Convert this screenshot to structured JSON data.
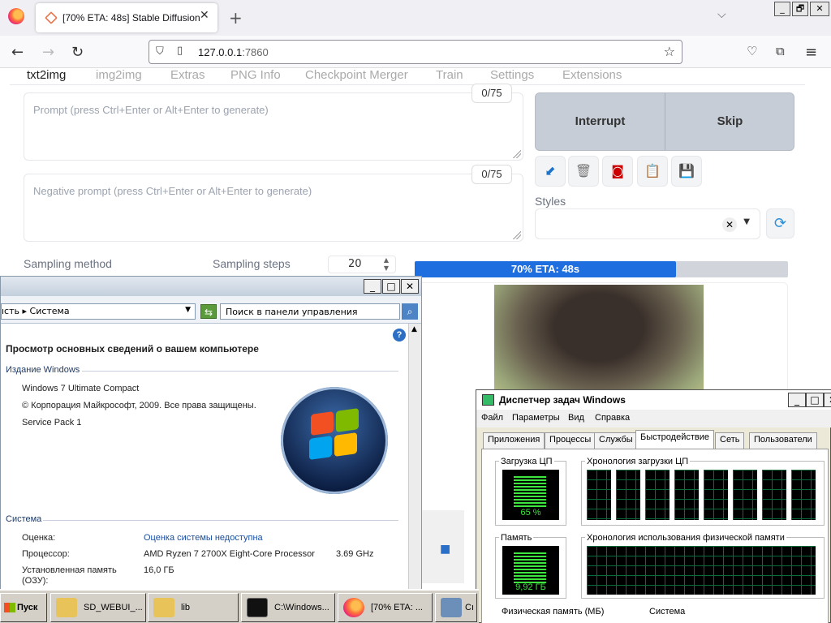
{
  "browser": {
    "tab_title": "[70% ETA: 48s] Stable Diffusion",
    "tab_close": "✕",
    "new_tab": "+",
    "address_host": "127.0.0.1",
    "address_port": ":7860",
    "window_buttons": [
      "_",
      "🗗",
      "✕"
    ]
  },
  "webui": {
    "tabs": [
      "txt2img",
      "img2img",
      "Extras",
      "PNG Info",
      "Checkpoint Merger",
      "Train",
      "Settings",
      "Extensions"
    ],
    "prompt": {
      "placeholder": "Prompt (press Ctrl+Enter or Alt+Enter to generate)",
      "counter": "0/75"
    },
    "negative_prompt": {
      "placeholder": "Negative prompt (press Ctrl+Enter or Alt+Enter to generate)",
      "counter": "0/75"
    },
    "interrupt_label": "Interrupt",
    "skip_label": "Skip",
    "styles_label": "Styles",
    "sampling_method_label": "Sampling method",
    "sampling_steps_label": "Sampling steps",
    "sampling_steps_value": "20",
    "progress": {
      "text": "70% ETA: 48s",
      "fraction": 0.7
    }
  },
  "system_window": {
    "breadcrumb": "ıсть  ▸  Система",
    "search_placeholder": "Поиск в панели управления",
    "heading": "Просмотр основных сведений о вашем компьютере",
    "edition_section": "Издание Windows",
    "edition_name": "Windows 7 Ultimate Compact",
    "copyright": "© Корпорация Майкрософт, 2009. Все права защищены.",
    "service_pack": "Service Pack 1",
    "system_section": "Система",
    "rating_label": "Оценка:",
    "rating_value": "Оценка системы недоступна",
    "cpu_label": "Процессор:",
    "cpu_value": "AMD Ryzen 7 2700X Eight-Core Processor",
    "cpu_freq": "3.69 GHz",
    "ram_label": "Установленная память (ОЗУ):",
    "ram_value": "16,0 ГБ",
    "help": "?"
  },
  "task_manager": {
    "title": "Диспетчер задач Windows",
    "menu": [
      "Файл",
      "Параметры",
      "Вид",
      "Справка"
    ],
    "tabs": [
      "Приложения",
      "Процессы",
      "Службы",
      "Быстродействие",
      "Сеть",
      "Пользователи"
    ],
    "cpu_group": "Загрузка ЦП",
    "cpu_value": "65 %",
    "cpu_history": "Хронология загрузки ЦП",
    "mem_group": "Память",
    "mem_value": "9,92 ГБ",
    "mem_history": "Хронология использования физической памяти",
    "phys_mem": "Физическая память (МБ)",
    "system": "Система"
  },
  "taskbar": {
    "start": "Пуск",
    "items": [
      "SD_WEBUI_...",
      "lib",
      "C:\\Windows...",
      "[70% ETA: ...",
      "Сı"
    ]
  }
}
